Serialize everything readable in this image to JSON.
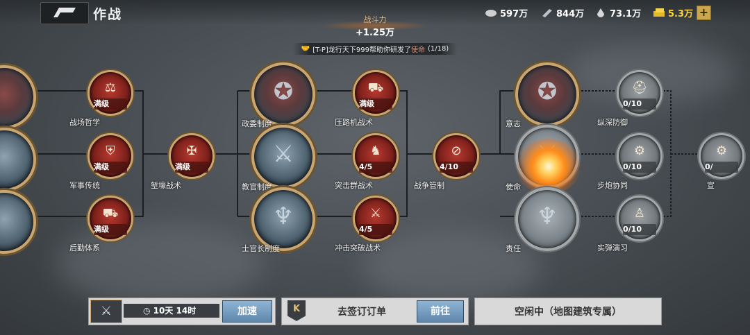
{
  "header": {
    "title": "作战",
    "resources": [
      {
        "icon": "food-icon",
        "value": "597万"
      },
      {
        "icon": "steel-icon",
        "value": "844万"
      },
      {
        "icon": "oil-icon",
        "value": "73.1万"
      },
      {
        "icon": "gold-icon",
        "value": "5.3万"
      }
    ],
    "plus_label": "+"
  },
  "power": {
    "label": "战斗力",
    "value": "+1.25万"
  },
  "help_message": {
    "player": "[T-P]龙行天下999",
    "text": "帮助你研发了",
    "tech": "使命",
    "progress": "(1/18)"
  },
  "nodes": {
    "zhanchang_zhexue": {
      "label": "战场哲学",
      "level": "满级",
      "icon": "scales-icon"
    },
    "junshi_chuantong": {
      "label": "军事传统",
      "level": "满级",
      "icon": "shield-icon"
    },
    "houqin_tixi": {
      "label": "后勤体系",
      "level": "满级",
      "icon": "truck-icon"
    },
    "qianhao_zhanshu": {
      "label": "堑壕战术",
      "level": "满级",
      "icon": "barbed-wire-icon"
    },
    "zhengwei_zhidu": {
      "label": "政委制度",
      "icon": "star-emblem-icon"
    },
    "jiaoguan_zhidu": {
      "label": "教官制度",
      "icon": "sword-emblem-icon"
    },
    "shiguanzhang_zhidu": {
      "label": "士官长制度",
      "icon": "wing-emblem-icon"
    },
    "yaluji_zhanshu": {
      "label": "压路机战术",
      "level": "满级",
      "icon": "tank-icon"
    },
    "tujiqun_zhanshu": {
      "label": "突击群战术",
      "level": "4/5",
      "icon": "soldiers-icon"
    },
    "chongji_tupo": {
      "label": "冲击突破战术",
      "level": "4/5",
      "icon": "assault-icon"
    },
    "zhanzheng_guanzhi": {
      "label": "战争管制",
      "level": "4/10",
      "icon": "no-bomb-icon"
    },
    "yizhi": {
      "label": "意志",
      "icon": "star-emblem-icon"
    },
    "shiming": {
      "label": "使命",
      "icon": "sword-emblem-icon"
    },
    "zeren": {
      "label": "责任",
      "icon": "wing-emblem-icon"
    },
    "zongshen_fangyu": {
      "label": "纵深防御",
      "level": "0/10",
      "icon": "helmet-icon"
    },
    "bupao_xietong": {
      "label": "步炮协同",
      "level": "0/10",
      "icon": "artillery-icon"
    },
    "shidan_yanxi": {
      "label": "实弹演习",
      "level": "0/10",
      "icon": "rifleman-icon"
    },
    "xuan_partial": {
      "label": "宣",
      "level": "0/",
      "icon": "unknown-icon"
    }
  },
  "bottom": {
    "research_timer": "10天 14时",
    "speedup_label": "加速",
    "order_text": "去签订订单",
    "goto_label": "前往",
    "idle_text": "空闲中（地图建筑专属）"
  }
}
